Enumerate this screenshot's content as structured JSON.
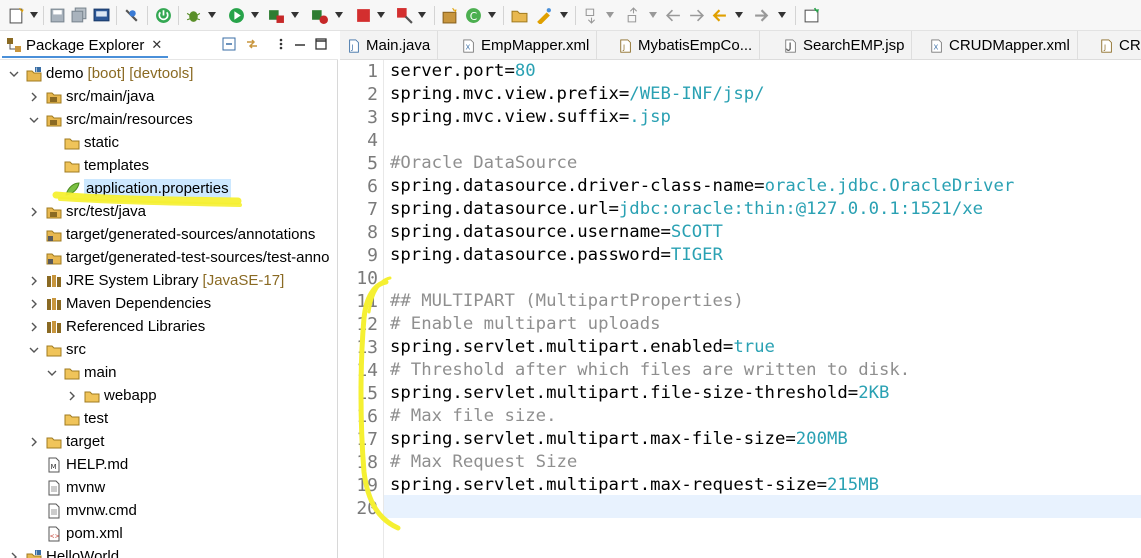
{
  "explorer": {
    "tab_label": "Package Explorer",
    "close_label": "✕",
    "tree": [
      {
        "label": "demo",
        "deco": "[boot] [devtools]"
      },
      {
        "label": "src/main/java"
      },
      {
        "label": "src/main/resources"
      },
      {
        "label": "static"
      },
      {
        "label": "templates"
      },
      {
        "label": "application.properties"
      },
      {
        "label": "src/test/java"
      },
      {
        "label": "target/generated-sources/annotations"
      },
      {
        "label": "target/generated-test-sources/test-anno"
      },
      {
        "label": "JRE System Library",
        "deco": "[JavaSE-17]"
      },
      {
        "label": "Maven Dependencies"
      },
      {
        "label": "Referenced Libraries"
      },
      {
        "label": "src"
      },
      {
        "label": "main"
      },
      {
        "label": "webapp"
      },
      {
        "label": "test"
      },
      {
        "label": "target"
      },
      {
        "label": "HELP.md"
      },
      {
        "label": "mvnw"
      },
      {
        "label": "mvnw.cmd"
      },
      {
        "label": "pom.xml"
      },
      {
        "label": "HelloWorld"
      }
    ]
  },
  "editor": {
    "tabs": [
      {
        "label": "Main.java"
      },
      {
        "label": "EmpMapper.xml"
      },
      {
        "label": "MybatisEmpCo..."
      },
      {
        "label": "SearchEMP.jsp"
      },
      {
        "label": "CRUDMapper.xml"
      },
      {
        "label": "CRU"
      }
    ],
    "lines": [
      {
        "n": "1",
        "key": "server.port=",
        "val": "80",
        "comment": ""
      },
      {
        "n": "2",
        "key": "spring.mvc.view.prefix=",
        "val": "/WEB-INF/jsp/",
        "comment": ""
      },
      {
        "n": "3",
        "key": "spring.mvc.view.suffix=",
        "val": ".jsp",
        "comment": ""
      },
      {
        "n": "4",
        "key": "",
        "val": "",
        "comment": ""
      },
      {
        "n": "5",
        "key": "",
        "val": "",
        "comment": "#Oracle DataSource"
      },
      {
        "n": "6",
        "key": "spring.datasource.driver-class-name=",
        "val": "oracle.jdbc.OracleDriver",
        "comment": ""
      },
      {
        "n": "7",
        "key": "spring.datasource.url=",
        "val": "jdbc:oracle:thin:@127.0.0.1:1521/xe",
        "comment": ""
      },
      {
        "n": "8",
        "key": "spring.datasource.username=",
        "val": "SCOTT",
        "comment": ""
      },
      {
        "n": "9",
        "key": "spring.datasource.password=",
        "val": "TIGER",
        "comment": ""
      },
      {
        "n": "10",
        "key": "",
        "val": "",
        "comment": ""
      },
      {
        "n": "11",
        "key": "",
        "val": "",
        "comment": "## MULTIPART (MultipartProperties)"
      },
      {
        "n": "12",
        "key": "",
        "val": "",
        "comment": "# Enable multipart uploads"
      },
      {
        "n": "13",
        "key": "spring.servlet.multipart.enabled=",
        "val": "true",
        "comment": ""
      },
      {
        "n": "14",
        "key": "",
        "val": "",
        "comment": "# Threshold after which files are written to disk."
      },
      {
        "n": "15",
        "key": "spring.servlet.multipart.file-size-threshold=",
        "val": "2KB",
        "comment": ""
      },
      {
        "n": "16",
        "key": "",
        "val": "",
        "comment": "# Max file size."
      },
      {
        "n": "17",
        "key": "spring.servlet.multipart.max-file-size=",
        "val": "200MB",
        "comment": ""
      },
      {
        "n": "18",
        "key": "",
        "val": "",
        "comment": "# Max Request Size"
      },
      {
        "n": "19",
        "key": "spring.servlet.multipart.max-request-size=",
        "val": "215MB",
        "comment": ""
      },
      {
        "n": "20",
        "key": "",
        "val": "",
        "comment": ""
      }
    ]
  },
  "colors": {
    "property_value": "#2aa1b3",
    "comment": "#8f8f8f",
    "highlighter": "#f5f032",
    "selection": "#cce8ff"
  }
}
